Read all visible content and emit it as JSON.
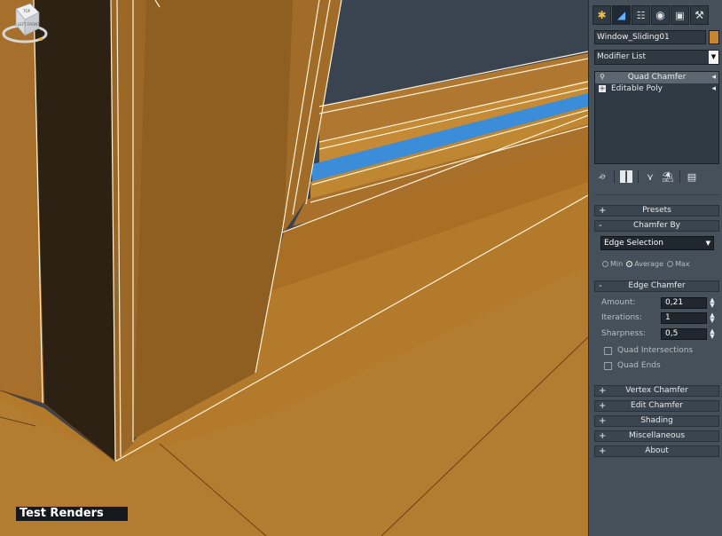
{
  "viewport": {
    "label": "Test Renders",
    "viewcube_faces": [
      "TOP",
      "LEFT",
      "FRONT"
    ]
  },
  "panel": {
    "top_tabs": [
      "create-icon",
      "modify-icon",
      "hierarchy-icon",
      "motion-icon",
      "display-icon",
      "utilities-icon"
    ],
    "object_name": "Window_Sliding01",
    "object_color": "#c7862d",
    "modifier_list_label": "Modifier List",
    "stack": [
      {
        "label": "Quad Chamfer",
        "icon": "lightbulb-icon",
        "selected": true
      },
      {
        "label": "Editable Poly",
        "icon": "expand-icon",
        "selected": false
      }
    ],
    "rollouts": {
      "presets": "Presets",
      "chamfer_by": "Chamfer By",
      "edge_chamfer": "Edge Chamfer",
      "vertex_chamfer": "Vertex Chamfer",
      "edit_chamfer": "Edit Chamfer",
      "shading": "Shading",
      "misc": "Miscellaneous",
      "about": "About"
    },
    "chamfer_by_value": "Edge Selection",
    "radio_options": [
      "Min",
      "Average",
      "Max"
    ],
    "radio_selected": "Average",
    "params": [
      {
        "label": "Amount:",
        "value": "0,21"
      },
      {
        "label": "Iterations:",
        "value": "1"
      },
      {
        "label": "Sharpness:",
        "value": "0,5"
      }
    ],
    "checkboxes": [
      {
        "label": "Quad Intersections",
        "checked": false
      },
      {
        "label": "Quad Ends",
        "checked": false
      }
    ]
  },
  "colors": {
    "wood_light": "#b8812f",
    "wood_mid": "#9c6a23",
    "wood_dark": "#2d2114",
    "glass_blue": "#3b8cd9",
    "panel_bg": "#46505b"
  }
}
